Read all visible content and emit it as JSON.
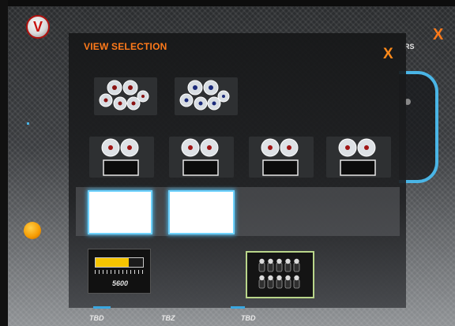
{
  "app": {
    "logo_letter": "V",
    "outer_close_label": "X",
    "side_badge": "RS"
  },
  "modal": {
    "title": "VIEW SELECTION",
    "close_label": "X",
    "layouts": [
      {
        "name": "six-gauge-cluster-a",
        "type": "six-gauges"
      },
      {
        "name": "six-gauge-cluster-b",
        "type": "six-gauges"
      },
      {
        "name": "two-gauges-screen-1",
        "type": "two-gauges-display"
      },
      {
        "name": "two-gauges-screen-2",
        "type": "two-gauges-display"
      },
      {
        "name": "two-gauges-screen-3",
        "type": "two-gauges-display"
      },
      {
        "name": "two-gauges-screen-4",
        "type": "two-gauges-display"
      },
      {
        "name": "blank-screen-1",
        "type": "blank"
      },
      {
        "name": "blank-screen-2",
        "type": "blank"
      },
      {
        "name": "rpm-shift-light",
        "type": "rpm-bar"
      },
      {
        "name": "switch-panel",
        "type": "switch-panel"
      }
    ],
    "rpm_tile": {
      "value": "5600",
      "fill_fraction": 0.7,
      "bar_color": "#f5c400"
    },
    "switch_tile": {
      "rows": 2,
      "columns": 5,
      "border_color": "#b9d58a"
    }
  },
  "bottom_labels": [
    "TBD",
    "TBZ",
    "TBD"
  ],
  "colors": {
    "accent_orange": "#ff7a1a",
    "accent_blue": "#4ab5e6",
    "brand_red": "#c8120d"
  },
  "icons": [
    "logo-icon",
    "gauge-icon",
    "close-icon",
    "toggle-switch-icon"
  ]
}
